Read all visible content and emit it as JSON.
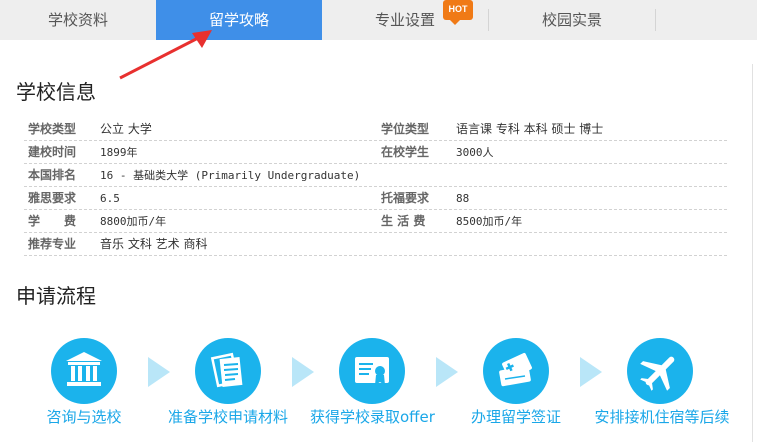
{
  "tabs": [
    {
      "label": "学校资料"
    },
    {
      "label": "留学攻略"
    },
    {
      "label": "专业设置",
      "badge": "HOT"
    },
    {
      "label": "校园实景"
    }
  ],
  "info": {
    "title": "学校信息",
    "rows": [
      {
        "l1": "学校类型",
        "v1": "公立 大学",
        "l2": "学位类型",
        "v2": "语言课 专科 本科 硕士 博士"
      },
      {
        "l1": "建校时间",
        "v1": "1899年",
        "l2": "在校学生",
        "v2": "3000人"
      },
      {
        "l1": "本国排名",
        "v1": "16 - 基础类大学 (Primarily Undergraduate)",
        "l2": "",
        "v2": ""
      },
      {
        "l1": "雅思要求",
        "v1": "6.5",
        "l2": "托福要求",
        "v2": "88"
      },
      {
        "l1": "学　　费",
        "v1": "8800加币/年",
        "l2": "生 活 费",
        "v2": "8500加币/年"
      },
      {
        "l1": "推荐专业",
        "v1": "音乐 文科 艺术 商科",
        "l2": "",
        "v2": ""
      }
    ]
  },
  "process": {
    "title": "申请流程",
    "steps": [
      {
        "label": "咨询与选校",
        "icon": "school-building-icon"
      },
      {
        "label": "准备学校申请材料",
        "icon": "documents-icon"
      },
      {
        "label": "获得学校录取offer",
        "icon": "certificate-icon"
      },
      {
        "label": "办理留学签证",
        "icon": "passport-icon"
      },
      {
        "label": "安排接机住宿等后续",
        "icon": "airplane-icon"
      }
    ]
  },
  "colors": {
    "tab_active": "#3f8fe8",
    "hot_badge": "#f07a16",
    "step_circle": "#1bb3ec",
    "step_label": "#1aa7e8",
    "step_arrow": "#b9e6f8",
    "annotation_arrow": "#e8302f"
  }
}
